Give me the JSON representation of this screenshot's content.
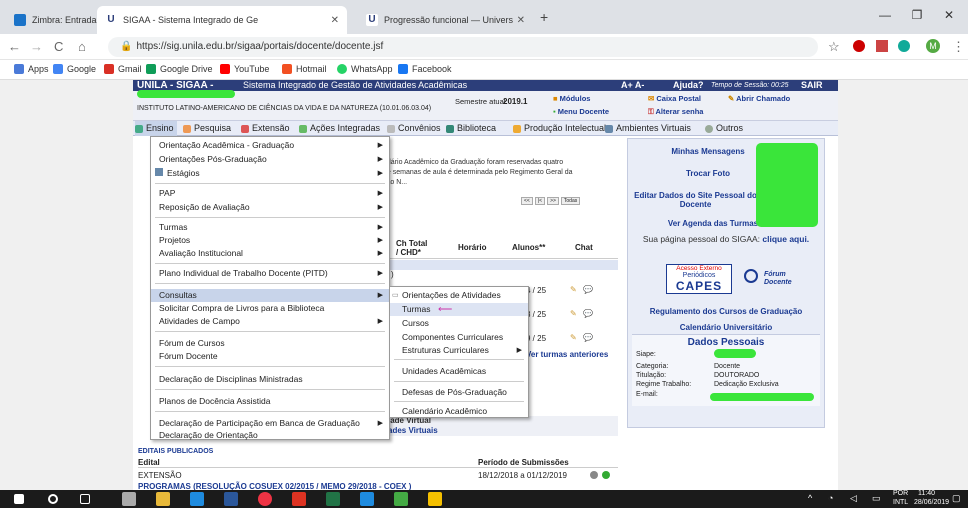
{
  "browser": {
    "tabs": [
      {
        "title": "Zimbra: Entrada (96)",
        "color": "#1a73c8"
      },
      {
        "title": "SIGAA - Sistema Integrado de Ge",
        "color": "#2c3e7a"
      },
      {
        "title": "Progressão funcional — Univers",
        "color": "#2c3e7a"
      }
    ],
    "new_tab": "+",
    "url": "https://sig.unila.edu.br/sigaa/portais/docente/docente.jsf",
    "bookmarks": [
      "Apps",
      "Google",
      "Gmail",
      "Google Drive",
      "YouTube",
      "Hotmail",
      "WhatsApp",
      "Facebook"
    ]
  },
  "sigaa": {
    "brand": "UNILA - SIGAA -",
    "system_name": "Sistema Integrado de Gestão de Atividades Acadêmicas",
    "font_controls": "A+ A-",
    "help": "Ajuda?",
    "session": "Tempo de Sessão: 00:25",
    "exit": "SAIR",
    "institute": "INSTITUTO LATINO-AMERICANO DE CIÊNCIAS DA VIDA E DA NATUREZA (10.01.06.03.04)",
    "semester_label": "Semestre atual:",
    "semester": "2019.1",
    "links": {
      "modulos": "Módulos",
      "caixa_postal": "Caixa Postal",
      "abrir_chamado": "Abrir Chamado",
      "menu_docente": "Menu Docente",
      "alterar_senha": "Alterar senha"
    },
    "menu": [
      "Ensino",
      "Pesquisa",
      "Extensão",
      "Ações Integradas",
      "Convênios",
      "Biblioteca",
      "Produção Intelectual",
      "Ambientes Virtuais",
      "Outros"
    ]
  },
  "ensino_menu": [
    {
      "label": "Orientação Acadêmica - Graduação",
      "arrow": true
    },
    {
      "label": "Orientações Pós-Graduação",
      "arrow": true
    },
    {
      "label": "Estágios",
      "arrow": true
    },
    {
      "label": "PAP",
      "arrow": true
    },
    {
      "label": "Reposição de Avaliação",
      "arrow": true
    },
    {
      "label": "Turmas",
      "arrow": true
    },
    {
      "label": "Projetos",
      "arrow": true
    },
    {
      "label": "Avaliação Institucional",
      "arrow": true
    },
    {
      "label": "Plano Individual de Trabalho Docente (PITD)",
      "arrow": true
    },
    {
      "label": "Consultas",
      "arrow": true
    },
    {
      "label": "Solicitar Compra de Livros para a Biblioteca",
      "arrow": false
    },
    {
      "label": "Atividades de Campo",
      "arrow": true
    },
    {
      "label": "Fórum de Cursos",
      "arrow": false
    },
    {
      "label": "Fórum Docente",
      "arrow": false
    },
    {
      "label": "Declaração de Disciplinas Ministradas",
      "arrow": false
    },
    {
      "label": "Planos de Docência Assistida",
      "arrow": false
    },
    {
      "label": "Declaração de Participação em Banca de Graduação",
      "arrow": true
    },
    {
      "label": "Declaração de Orientação",
      "arrow": false
    }
  ],
  "consultas_submenu": [
    {
      "label": "Orientações de Atividades",
      "arrow": false
    },
    {
      "label": "Turmas",
      "arrow": false
    },
    {
      "label": "Cursos",
      "arrow": false
    },
    {
      "label": "Componentes Curriculares",
      "arrow": false
    },
    {
      "label": "Estruturas Curriculares",
      "arrow": true
    },
    {
      "label": "Unidades Acadêmicas",
      "arrow": false
    },
    {
      "label": "Defesas de Pós-Graduação",
      "arrow": false
    },
    {
      "label": "Calendário Acadêmico",
      "arrow": false
    }
  ],
  "main": {
    "notice": "ndário Acadêmico da Graduação foram reservadas quatro\nde semanas de aula é determinada pelo Regimento Geral da\nção N...",
    "pager": [
      "<<",
      "|<",
      ">>",
      "Todas"
    ],
    "table_headers": [
      "Ch Total\n/ CHD*",
      "Horário",
      "Alunos**",
      "Chat"
    ],
    "rows": [
      {
        "alunos": "4 / 25"
      },
      {
        "alunos": "3 / 25"
      },
      {
        "alunos": "9 / 25"
      }
    ],
    "row_prefix": ")",
    "ver_anteriores": "Ver turmas anteriores",
    "ambientes_1": "lade Virtual",
    "ambientes_2": "ades Virtuais",
    "editais_title": "Editais Publicados",
    "editais_col1": "Edital",
    "editais_col2": "Período de Submissões",
    "edital_name": "EXTENSÃO",
    "edital_period": "18/12/2018 a 01/12/2019",
    "edital_next": "PROGRAMAS (RESOLUÇÃO COSUEX 02/2015 / MEMO 29/2018 - COEX )"
  },
  "right": {
    "mensagens": "Minhas Mensagens",
    "trocar_foto": "Trocar Foto",
    "editar": "Editar Dados do Site Pessoal do Docente",
    "agenda": "Ver Agenda das Turmas",
    "pagina_pessoal": "Sua página pessoal do SIGAA:",
    "clique": "clique aqui.",
    "capes_top": "Acesso Externo",
    "capes_mid": "Periódicos",
    "capes_logo": "CAPES",
    "forum": "Fórum Docente",
    "regulamento": "Regulamento dos Cursos de Graduação",
    "calendario": "Calendário Universitário",
    "dados_title": "Dados Pessoais",
    "siape": "Siape:",
    "categoria": "Categoria:",
    "categoria_val": "Docente",
    "titulacao": "Titulação:",
    "titulacao_val": "DOUTORADO",
    "regime": "Regime Trabalho:",
    "regime_val": "Dedicação Exclusiva",
    "email": "E-mail:"
  },
  "taskbar": {
    "lang1": "POR",
    "lang2": "INTL",
    "time": "11:40",
    "date": "28/06/2019"
  }
}
